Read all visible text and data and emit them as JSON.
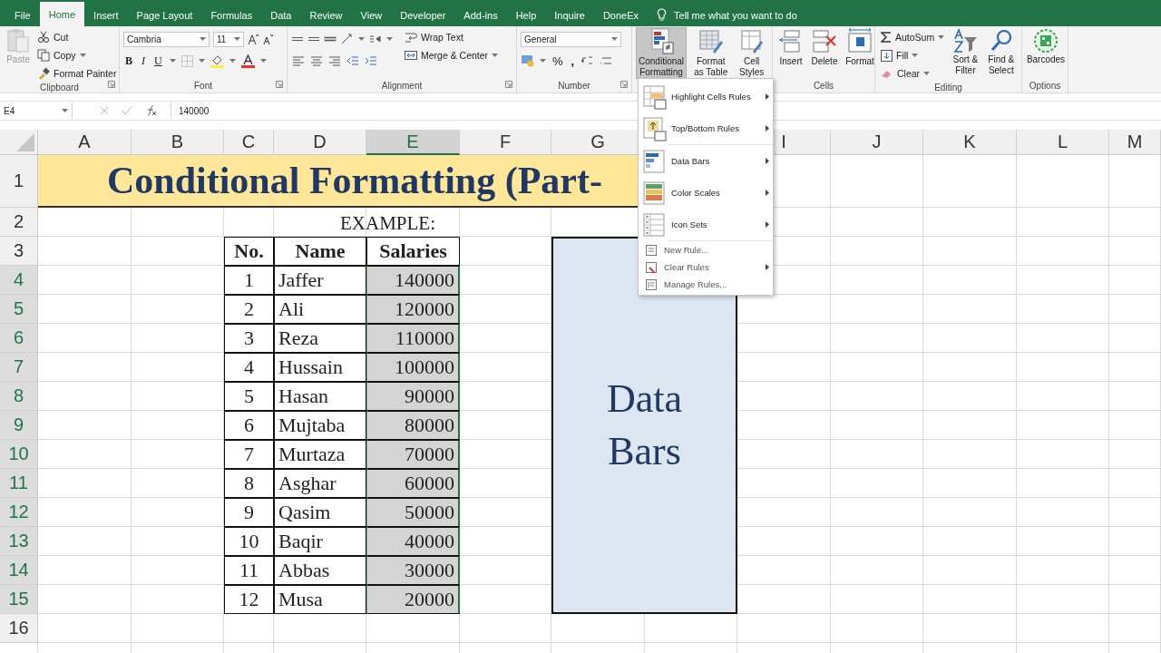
{
  "tabs": [
    {
      "label": "File",
      "selected": false
    },
    {
      "label": "Home",
      "selected": true
    },
    {
      "label": "Insert",
      "selected": false
    },
    {
      "label": "Page Layout",
      "selected": false
    },
    {
      "label": "Formulas",
      "selected": false
    },
    {
      "label": "Data",
      "selected": false
    },
    {
      "label": "Review",
      "selected": false
    },
    {
      "label": "View",
      "selected": false
    },
    {
      "label": "Developer",
      "selected": false
    },
    {
      "label": "Add-ins",
      "selected": false
    },
    {
      "label": "Help",
      "selected": false
    },
    {
      "label": "Inquire",
      "selected": false
    },
    {
      "label": "DoneEx",
      "selected": false
    }
  ],
  "tell_me": "Tell me what you want to do",
  "ribbon": {
    "clipboard": {
      "label": "Clipboard",
      "paste": {
        "label": "Paste",
        "disabled": true
      },
      "cut": "Cut",
      "copy": "Copy",
      "format_painter": "Format Painter"
    },
    "font": {
      "label": "Font",
      "family": "Cambria",
      "size": "11",
      "bold": "B",
      "italic": "I",
      "underline": "U"
    },
    "alignment": {
      "label": "Alignment",
      "wrap_text": "Wrap Text",
      "merge_center": "Merge & Center"
    },
    "number": {
      "label": "Number",
      "format": "General",
      "percent": "%",
      "comma": ","
    },
    "styles": {
      "conditional_formatting": {
        "label": "Conditional Formatting",
        "pressed": true
      },
      "format_as_table": "Format as Table",
      "cell_styles": "Cell Styles"
    },
    "cells": {
      "label": "Cells",
      "insert": "Insert",
      "delete": "Delete",
      "format": "Format"
    },
    "editing": {
      "label": "Editing",
      "autosum": "AutoSum",
      "fill": "Fill",
      "clear": "Clear",
      "sort_filter": "Sort & Filter",
      "find_select": "Find & Select"
    },
    "options": {
      "label": "Options",
      "barcodes": "Barcodes"
    }
  },
  "formula_bar": {
    "name_box": "E4",
    "formula": "140000"
  },
  "sheet": {
    "columns": [
      {
        "label": "A",
        "selected": false
      },
      {
        "label": "B",
        "selected": false
      },
      {
        "label": "C",
        "selected": false
      },
      {
        "label": "D",
        "selected": false
      },
      {
        "label": "E",
        "selected": true
      },
      {
        "label": "F",
        "selected": false
      },
      {
        "label": "G",
        "selected": false
      },
      {},
      {
        "label": "I",
        "selected": false
      },
      {
        "label": "J",
        "selected": false
      },
      {
        "label": "K",
        "selected": false
      },
      {
        "label": "L",
        "selected": false
      },
      {
        "label": "M",
        "selected": false
      }
    ],
    "rows": [
      {
        "label": "1",
        "selected": false
      },
      {
        "label": "2",
        "selected": false
      },
      {
        "label": "3",
        "selected": false
      },
      {
        "label": "4",
        "selected": true
      },
      {
        "label": "5",
        "selected": true
      },
      {
        "label": "6",
        "selected": true
      },
      {
        "label": "7",
        "selected": true
      },
      {
        "label": "8",
        "selected": true
      },
      {
        "label": "9",
        "selected": true
      },
      {
        "label": "10",
        "selected": true
      },
      {
        "label": "11",
        "selected": true
      },
      {
        "label": "12",
        "selected": true
      },
      {
        "label": "13",
        "selected": true
      },
      {
        "label": "14",
        "selected": true
      },
      {
        "label": "15",
        "selected": true
      },
      {
        "label": "16",
        "selected": false
      }
    ],
    "title": "Conditional Formatting (Part-",
    "caption": "EXAMPLE:",
    "table": {
      "headers": [
        "No.",
        "Name",
        "Salaries"
      ],
      "rows": [
        {
          "no": "1",
          "name": "Jaffer",
          "salary": "140000",
          "selected": true
        },
        {
          "no": "2",
          "name": "Ali",
          "salary": "120000",
          "selected": true
        },
        {
          "no": "3",
          "name": "Reza",
          "salary": "110000",
          "selected": true
        },
        {
          "no": "4",
          "name": "Hussain",
          "salary": "100000",
          "selected": true
        },
        {
          "no": "5",
          "name": "Hasan",
          "salary": "90000",
          "selected": true
        },
        {
          "no": "6",
          "name": "Mujtaba",
          "salary": "80000",
          "selected": true
        },
        {
          "no": "7",
          "name": "Murtaza",
          "salary": "70000",
          "selected": true
        },
        {
          "no": "8",
          "name": "Asghar",
          "salary": "60000",
          "selected": true
        },
        {
          "no": "9",
          "name": "Qasim",
          "salary": "50000",
          "selected": true
        },
        {
          "no": "10",
          "name": "Baqir",
          "salary": "40000",
          "selected": true
        },
        {
          "no": "11",
          "name": "Abbas",
          "salary": "30000",
          "selected": true
        },
        {
          "no": "12",
          "name": "Musa",
          "salary": "20000",
          "selected": true
        }
      ]
    },
    "note": "Data Bars"
  },
  "menu": {
    "items": [
      {
        "kind": "large",
        "label": "Highlight Cells Rules",
        "submenu": true
      },
      {
        "kind": "large",
        "label": "Top/Bottom Rules",
        "submenu": true
      },
      {
        "kind": "large",
        "label": "Data Bars",
        "submenu": true
      },
      {
        "kind": "large",
        "label": "Color Scales",
        "submenu": true
      },
      {
        "kind": "large",
        "label": "Icon Sets",
        "submenu": true
      },
      {
        "kind": "small",
        "label": "New Rule...",
        "submenu": false
      },
      {
        "kind": "small",
        "label": "Clear Rules",
        "submenu": true
      },
      {
        "kind": "small",
        "label": "Manage Rules...",
        "submenu": false
      }
    ]
  }
}
